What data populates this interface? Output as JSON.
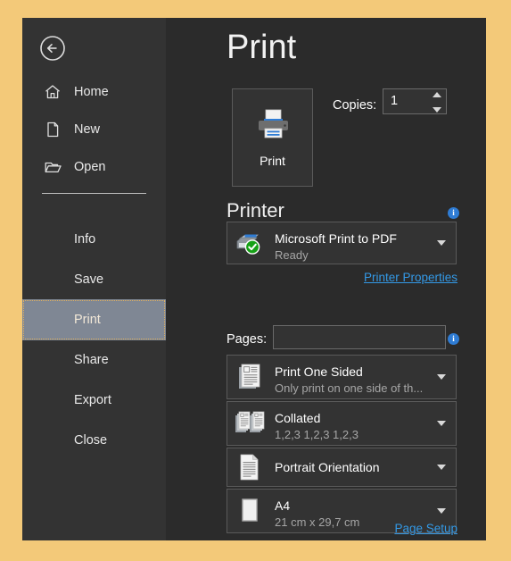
{
  "theme": {
    "outer_background": "#f3c979",
    "window_background": "#2b2b2b",
    "sidebar_background": "#333333",
    "selection_background": "#7f8794",
    "selection_border": "#e0b060",
    "link_color": "#3399e6",
    "info_badge_color": "#2f7cd4",
    "printer_accent": "#2f7cd4",
    "ready_badge_color": "#16a016"
  },
  "sidebar": {
    "back_button": "back-arrow-icon",
    "items": [
      {
        "label": "Home",
        "icon": "home-icon",
        "indent": false,
        "selected": false
      },
      {
        "label": "New",
        "icon": "new-file-icon",
        "indent": false,
        "selected": false
      },
      {
        "label": "Open",
        "icon": "open-folder-icon",
        "indent": false,
        "selected": false
      },
      {
        "label": "Info",
        "icon": "",
        "indent": true,
        "selected": false
      },
      {
        "label": "Save",
        "icon": "",
        "indent": true,
        "selected": false
      },
      {
        "label": "Print",
        "icon": "",
        "indent": true,
        "selected": true
      },
      {
        "label": "Share",
        "icon": "",
        "indent": true,
        "selected": false
      },
      {
        "label": "Export",
        "icon": "",
        "indent": true,
        "selected": false
      },
      {
        "label": "Close",
        "icon": "",
        "indent": true,
        "selected": false
      }
    ]
  },
  "main": {
    "title": "Print",
    "print_button": {
      "label": "Print",
      "icon": "printer-icon"
    },
    "copies": {
      "label": "Copies:",
      "value": "1",
      "spinner_up": "spinner-up-icon",
      "spinner_down": "spinner-down-icon"
    },
    "printer_section": {
      "heading": "Printer",
      "info_icon": "info-icon",
      "selected_printer": {
        "name": "Microsoft Print to PDF",
        "status": "Ready",
        "icon": "printer-ready-icon"
      },
      "properties_link": "Printer Properties"
    },
    "settings_section": {
      "pages_label": "Pages:",
      "pages_value": "",
      "pages_placeholder": "",
      "info_icon": "info-icon",
      "options": [
        {
          "title": "Print One Sided",
          "subtitle": "Only print on one side of th...",
          "icon": "one-sided-icon"
        },
        {
          "title": "Collated",
          "subtitle": "1,2,3   1,2,3   1,2,3",
          "icon": "collated-icon"
        },
        {
          "title": "Portrait Orientation",
          "subtitle": "",
          "icon": "portrait-icon"
        },
        {
          "title": "A4",
          "subtitle": "21 cm x 29,7 cm",
          "icon": "paper-size-icon"
        }
      ],
      "page_setup_link": "Page Setup"
    }
  }
}
